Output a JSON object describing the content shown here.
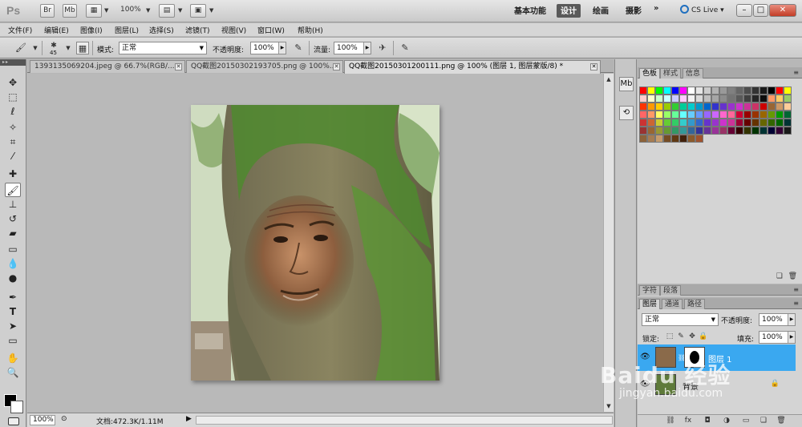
{
  "appbar": {
    "logo": "Ps",
    "br_label": "Br",
    "mb_label": "Mb",
    "zoom": "100%",
    "workspaces": [
      "基本功能",
      "设计",
      "绘画",
      "摄影",
      "»"
    ],
    "active_workspace": "设计",
    "cslive_label": "CS Live"
  },
  "menu": [
    "文件(F)",
    "编辑(E)",
    "图像(I)",
    "图层(L)",
    "选择(S)",
    "滤镜(T)",
    "视图(V)",
    "窗口(W)",
    "帮助(H)"
  ],
  "options": {
    "brush_size": "45",
    "mode_label": "模式:",
    "mode_value": "正常",
    "opacity_label": "不透明度:",
    "opacity_value": "100%",
    "flow_label": "流量:",
    "flow_value": "100%"
  },
  "tabs": [
    {
      "title": "1393135069204.jpeg @ 66.7%(RGB/..."
    },
    {
      "title": "QQ截图20150302193705.png @ 100%..."
    },
    {
      "title": "QQ截图20150301200111.png @ 100% (图层 1, 图层蒙版/8) *"
    }
  ],
  "status": {
    "zoom": "100%",
    "doc_size": "文档:472.3K/1.11M"
  },
  "color_panel": {
    "tabs": [
      "色板",
      "样式",
      "信息"
    ],
    "swatches": [
      "#ff0000",
      "#ffff00",
      "#00ff00",
      "#00ffff",
      "#0000ff",
      "#ff00ff",
      "#ffffff",
      "#e6e6e6",
      "#cccccc",
      "#b3b3b3",
      "#999999",
      "#808080",
      "#666666",
      "#4d4d4d",
      "#333333",
      "#1a1a1a",
      "#000000",
      "#ff0000",
      "#ffff00",
      "#ffcccc",
      "#ffffcc",
      "#ccffcc",
      "#ccffff",
      "#ccccff",
      "#ffccff",
      "#f2f2f2",
      "#d9d9d9",
      "#bfbfbf",
      "#a6a6a6",
      "#8c8c8c",
      "#737373",
      "#595959",
      "#404040",
      "#262626",
      "#0d0d0d",
      "#ff9966",
      "#ffcc66",
      "#99cc66",
      "#ff3300",
      "#ff9900",
      "#ffcc00",
      "#99cc00",
      "#33cc33",
      "#00cc99",
      "#00cccc",
      "#0099cc",
      "#0066cc",
      "#3333cc",
      "#6633cc",
      "#9933cc",
      "#cc33cc",
      "#cc3399",
      "#cc3366",
      "#cc0000",
      "#996633",
      "#cc9966",
      "#ffcc99",
      "#ff6666",
      "#ff9966",
      "#ffff66",
      "#99ff66",
      "#66ff99",
      "#66ffff",
      "#66ccff",
      "#6699ff",
      "#9966ff",
      "#cc66ff",
      "#ff66cc",
      "#ff6699",
      "#cc0033",
      "#990000",
      "#993300",
      "#996600",
      "#669900",
      "#009900",
      "#006633",
      "#cc3333",
      "#cc6633",
      "#cccc33",
      "#66cc33",
      "#33cc66",
      "#33cccc",
      "#3399cc",
      "#3366cc",
      "#6633cc",
      "#9933cc",
      "#cc33cc",
      "#cc3399",
      "#990033",
      "#660000",
      "#663300",
      "#666600",
      "#336600",
      "#006600",
      "#003333",
      "#993333",
      "#996633",
      "#999933",
      "#669933",
      "#339966",
      "#339999",
      "#336699",
      "#333399",
      "#663399",
      "#993399",
      "#993366",
      "#660033",
      "#330000",
      "#333300",
      "#003300",
      "#003333",
      "#000033",
      "#330033",
      "#1a1a1a",
      "#8c6239",
      "#a67c52",
      "#c69c6d",
      "#754c24",
      "#603913",
      "#42210b",
      "#8b5a2b",
      "#a0522d"
    ]
  },
  "char_panel": {
    "tabs": [
      "字符",
      "段落"
    ]
  },
  "layers_panel": {
    "tabs": [
      "图层",
      "通道",
      "路径"
    ],
    "blend_mode": "正常",
    "opacity_label": "不透明度:",
    "opacity_value": "100%",
    "lock_label": "锁定:",
    "fill_label": "填充:",
    "fill_value": "100%",
    "layers": [
      {
        "name": "图层 1",
        "selected": true
      },
      {
        "name": "背景",
        "selected": false
      }
    ]
  },
  "watermark": {
    "title": "Baidu 经验",
    "url": "jingyan.baidu.com"
  }
}
